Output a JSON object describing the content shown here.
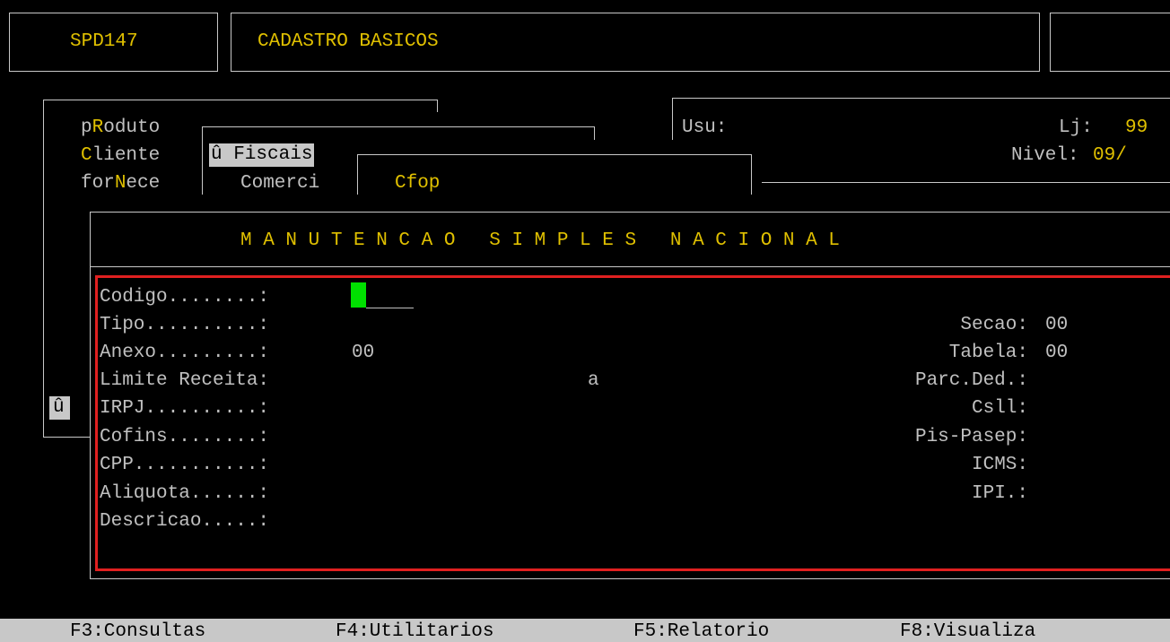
{
  "header": {
    "program_code": "SPD147",
    "screen_title": "CADASTRO BASICOS"
  },
  "user_panel": {
    "user_label": "Usu:",
    "store_label": "Lj:",
    "store_value": "99",
    "level_label": "Nivel:",
    "level_value": "09/"
  },
  "main_menu": {
    "items": [
      {
        "label": "pRoduto",
        "hotkey": "R"
      },
      {
        "label": "Cliente",
        "hotkey": "C"
      },
      {
        "label": "forNece",
        "hotkey": "N"
      }
    ],
    "marker": "û"
  },
  "submenu": {
    "items": [
      {
        "label": "û Fiscais",
        "selected": true
      },
      {
        "label": "Comerci",
        "selected": false
      }
    ]
  },
  "subsubmenu": {
    "items": [
      {
        "label": "Cfop"
      }
    ]
  },
  "panel": {
    "title": "M A N U T E N C A O   S I M P L E S   N A C I O N A L",
    "left_fields": [
      {
        "label": "Codigo........:",
        "value": ""
      },
      {
        "label": "Tipo..........:",
        "value": ""
      },
      {
        "label": "Anexo.........:",
        "value": "00"
      },
      {
        "label": "Limite Receita:",
        "value": ""
      },
      {
        "label": "IRPJ..........:",
        "value": ""
      },
      {
        "label": "Cofins........:",
        "value": ""
      },
      {
        "label": "CPP...........:",
        "value": ""
      },
      {
        "label": "Aliquota......:",
        "value": ""
      },
      {
        "label": "Descricao.....:",
        "value": ""
      }
    ],
    "range_separator": "a",
    "right_fields": [
      {
        "label": "Secao:",
        "value": "00"
      },
      {
        "label": "Tabela:",
        "value": "00"
      },
      {
        "label": "Parc.Ded.:",
        "value": ""
      },
      {
        "label": "Csll:",
        "value": ""
      },
      {
        "label": "Pis-Pasep:",
        "value": ""
      },
      {
        "label": "ICMS:",
        "value": ""
      },
      {
        "label": "IPI.:",
        "value": ""
      }
    ]
  },
  "function_keys": [
    {
      "label": "F3:Consultas"
    },
    {
      "label": "F4:Utilitarios"
    },
    {
      "label": "F5:Relatorio"
    },
    {
      "label": "F8:Visualiza"
    }
  ],
  "colors": {
    "hotkey": "#e0c000",
    "cursor": "#00e000",
    "panel_border": "#e02020",
    "text": "#c0c0c0",
    "background": "#000000"
  }
}
